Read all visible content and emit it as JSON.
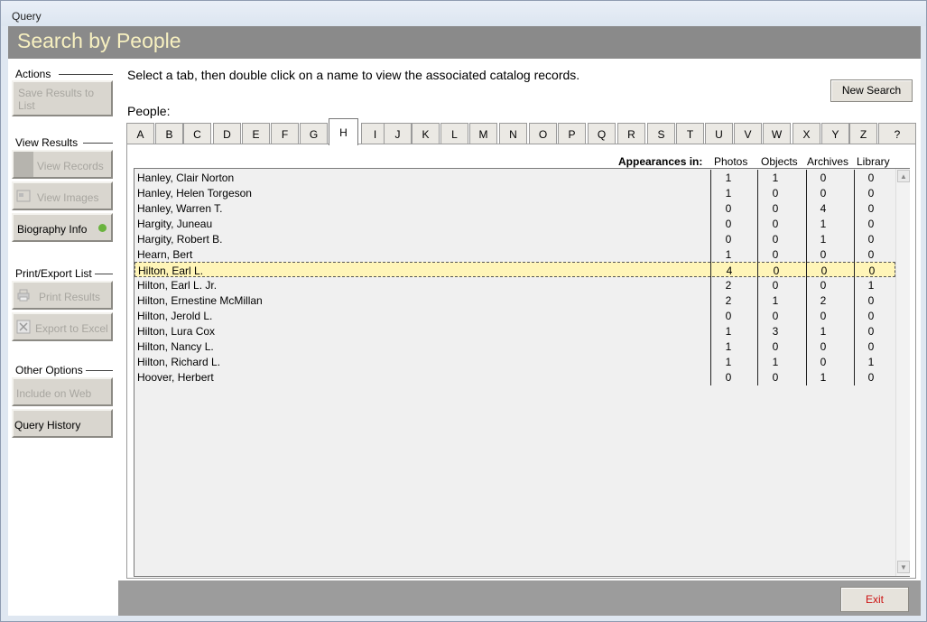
{
  "window": {
    "title": "Query"
  },
  "header": {
    "title": "Search by People"
  },
  "sidebar": {
    "groups": [
      {
        "label": "Actions",
        "buttons": [
          {
            "label": "Save Results to List",
            "enabled": false
          }
        ]
      },
      {
        "label": "View Results",
        "buttons": [
          {
            "label": "View Records",
            "enabled": false
          },
          {
            "label": "View Images",
            "enabled": false
          },
          {
            "label": "Biography Info",
            "enabled": true,
            "indicator_color": "#6ab33e"
          }
        ]
      },
      {
        "label": "Print/Export List",
        "buttons": [
          {
            "label": "Print Results",
            "enabled": false
          },
          {
            "label": "Export to Excel",
            "enabled": false
          }
        ]
      },
      {
        "label": "Other Options",
        "buttons": [
          {
            "label": "Include on Web",
            "enabled": false
          },
          {
            "label": "Query History",
            "enabled": true
          }
        ]
      }
    ]
  },
  "main": {
    "instructions": "Select a tab, then double click on a name to view the associated catalog records.",
    "new_search_label": "New Search",
    "people_label": "People:",
    "tabs": [
      "A",
      "B",
      "C",
      "D",
      "E",
      "F",
      "G",
      "H",
      "I",
      "J",
      "K",
      "L",
      "M",
      "N",
      "O",
      "P",
      "Q",
      "R",
      "S",
      "T",
      "U",
      "V",
      "W",
      "X",
      "Y",
      "Z",
      "?"
    ],
    "active_tab": "H",
    "columns": {
      "appearances": "Appearances in:",
      "photos": "Photos",
      "objects": "Objects",
      "archives": "Archives",
      "library": "Library"
    },
    "rows": [
      {
        "name": "Hanley, Clair Norton",
        "photos": "1",
        "objects": "1",
        "archives": "0",
        "library": "0"
      },
      {
        "name": "Hanley, Helen Torgeson",
        "photos": "1",
        "objects": "0",
        "archives": "0",
        "library": "0"
      },
      {
        "name": "Hanley, Warren T.",
        "photos": "0",
        "objects": "0",
        "archives": "4",
        "library": "0"
      },
      {
        "name": "Hargity, Juneau",
        "photos": "0",
        "objects": "0",
        "archives": "1",
        "library": "0"
      },
      {
        "name": "Hargity, Robert B.",
        "photos": "0",
        "objects": "0",
        "archives": "1",
        "library": "0"
      },
      {
        "name": "Hearn, Bert",
        "photos": "1",
        "objects": "0",
        "archives": "0",
        "library": "0"
      },
      {
        "name": "Hilton, Earl L.",
        "photos": "4",
        "objects": "0",
        "archives": "0",
        "library": "0",
        "selected": true
      },
      {
        "name": "Hilton, Earl L. Jr.",
        "photos": "2",
        "objects": "0",
        "archives": "0",
        "library": "1"
      },
      {
        "name": "Hilton, Ernestine McMillan",
        "photos": "2",
        "objects": "1",
        "archives": "2",
        "library": "0"
      },
      {
        "name": "Hilton, Jerold L.",
        "photos": "0",
        "objects": "0",
        "archives": "0",
        "library": "0"
      },
      {
        "name": "Hilton, Lura Cox",
        "photos": "1",
        "objects": "3",
        "archives": "1",
        "library": "0"
      },
      {
        "name": "Hilton, Nancy L.",
        "photos": "1",
        "objects": "0",
        "archives": "0",
        "library": "0"
      },
      {
        "name": "Hilton, Richard L.",
        "photos": "1",
        "objects": "1",
        "archives": "0",
        "library": "1"
      },
      {
        "name": "Hoover, Herbert",
        "photos": "0",
        "objects": "0",
        "archives": "1",
        "library": "0"
      }
    ],
    "exit_label": "Exit"
  }
}
